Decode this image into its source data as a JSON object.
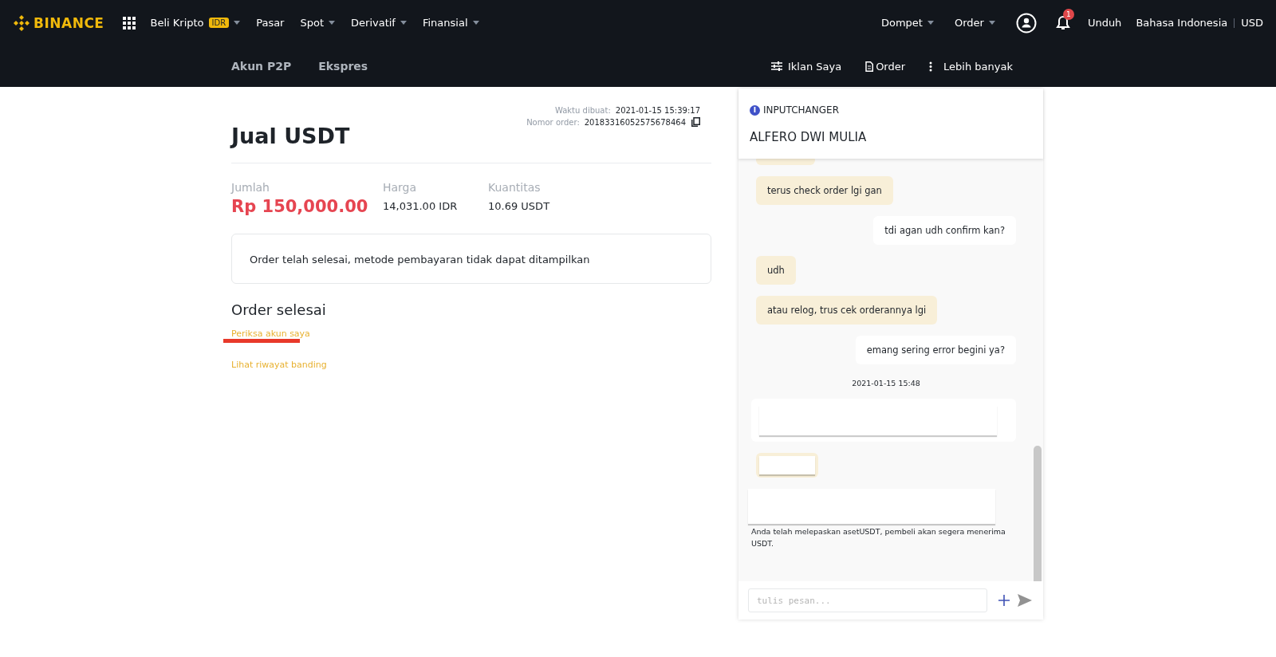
{
  "top_nav": {
    "logo": "BINANCE",
    "left_items": [
      {
        "label": "Beli Kripto",
        "badge": "IDR",
        "dropdown": true
      },
      {
        "label": "Pasar",
        "dropdown": false
      },
      {
        "label": "Spot",
        "dropdown": true
      },
      {
        "label": "Derivatif",
        "dropdown": true
      },
      {
        "label": "Finansial",
        "dropdown": true
      }
    ],
    "right_items": [
      {
        "label": "Dompet",
        "dropdown": true
      },
      {
        "label": "Order",
        "dropdown": true
      }
    ],
    "notification_count": "1",
    "download": "Unduh",
    "language": "Bahasa Indonesia",
    "currency": "USD"
  },
  "sub_nav": {
    "tabs": [
      {
        "label": "Akun P2P"
      },
      {
        "label": "Ekspres"
      }
    ],
    "actions": [
      {
        "kind": "sliders",
        "label": "Iklan Saya"
      },
      {
        "kind": "document",
        "label": "Order"
      },
      {
        "kind": "more",
        "label": "Lebih banyak"
      }
    ]
  },
  "order": {
    "title": "Jual USDT",
    "meta": [
      {
        "label": "Waktu dibuat:",
        "value": "2021-01-15 15:39:17",
        "copy": false
      },
      {
        "label": "Nomor order:",
        "value": "20183316052575678464",
        "copy": true
      }
    ],
    "stats": [
      {
        "label": "Jumlah",
        "value": "Rp 150,000.00",
        "highlight": true
      },
      {
        "label": "Harga",
        "value": "14,031.00 IDR",
        "highlight": false
      },
      {
        "label": "Kuantitas",
        "value": "10.69 USDT",
        "highlight": false
      }
    ],
    "notice": "Order telah selesai, metode pembayaran tidak dapat ditampilkan",
    "status": "Order selesai",
    "links": [
      {
        "label": "Periksa akun saya",
        "underlined": true
      },
      {
        "label": "Lihat riwayat banding",
        "underlined": false
      }
    ]
  },
  "chat": {
    "merchant_initial": "I",
    "merchant": "INPUTCHANGER",
    "name": "ALFERO DWI MULIA",
    "messages": [
      {
        "kind": "clipped"
      },
      {
        "kind": "incoming",
        "text": "terus check order lgi gan"
      },
      {
        "kind": "outgoing",
        "text": "tdi agan udh confirm kan?"
      },
      {
        "kind": "incoming",
        "text": "udh"
      },
      {
        "kind": "incoming",
        "text": "atau relog, trus cek orderannya lgi"
      },
      {
        "kind": "outgoing",
        "text": "emang sering error begini ya?"
      },
      {
        "kind": "timestamp",
        "text": "2021-01-15 15:48"
      },
      {
        "kind": "card-outgoing"
      },
      {
        "kind": "card-incoming"
      },
      {
        "kind": "card"
      },
      {
        "kind": "system",
        "text": "Anda telah melepaskan asetUSDT, pembeli akan segera menerima USDT."
      }
    ],
    "input": {
      "placeholder": "tulis pesan..."
    }
  }
}
